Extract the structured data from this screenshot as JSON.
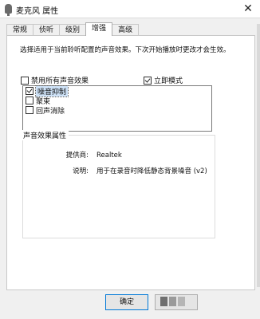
{
  "window": {
    "title": "麦克风 属性",
    "close_glyph": "✕"
  },
  "tabs": [
    {
      "label": "常规"
    },
    {
      "label": "侦听"
    },
    {
      "label": "级别"
    },
    {
      "label": "增强",
      "active": true
    },
    {
      "label": "高级"
    }
  ],
  "enhancements": {
    "description": "选择适用于当前聆听配置的声音效果。下次开始播放时更改才会生效。",
    "disable_all_label": "禁用所有声音效果",
    "disable_all_checked": false,
    "immediate_mode_label": "立即模式",
    "immediate_mode_checked": true,
    "effects": [
      {
        "label": "噪音抑制",
        "checked": true,
        "selected": true
      },
      {
        "label": "聚束",
        "checked": false,
        "selected": false
      },
      {
        "label": "回声消除",
        "checked": false,
        "selected": false
      }
    ],
    "properties_title": "声音效果属性",
    "provider_label": "提供商:",
    "provider_value": "Realtek",
    "description_label": "说明:",
    "description_value": "用于在录音时降低静态背景噪音 (v2)"
  },
  "buttons": {
    "ok_label": "确定"
  },
  "colors": {
    "accent": "#0078d7",
    "selection": "#cfe3f8"
  }
}
